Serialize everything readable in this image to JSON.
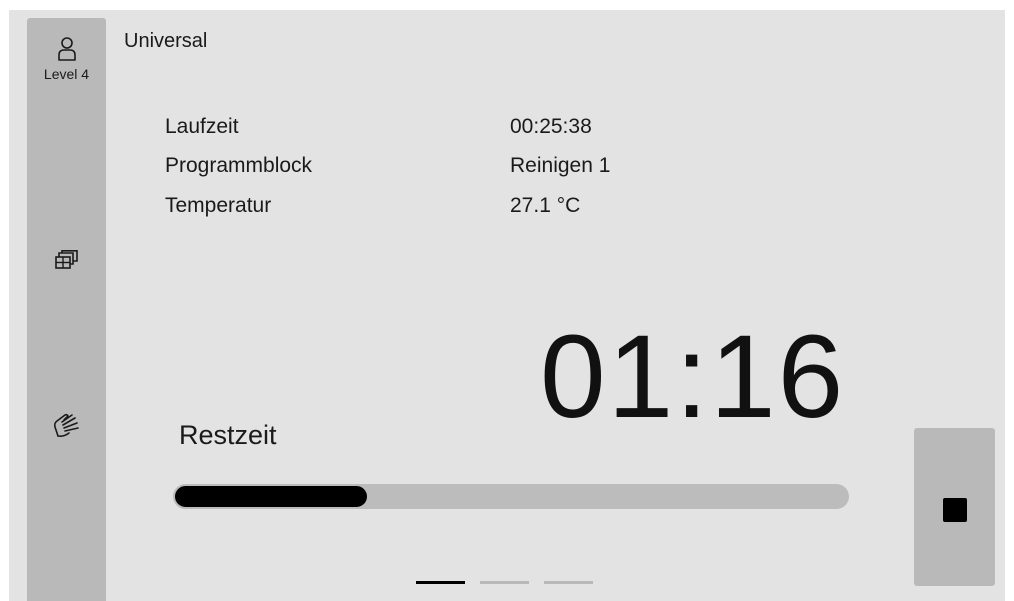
{
  "user": {
    "level_label": "Level 4",
    "icon": "user-icon"
  },
  "sidebar": {
    "items": [
      {
        "name": "user-level",
        "icon": "user-icon"
      },
      {
        "name": "load-carriers",
        "icon": "baskets-icon"
      },
      {
        "name": "hygiene",
        "icon": "hand-icon"
      }
    ]
  },
  "program": {
    "name": "Universal"
  },
  "info": {
    "runtime_label": "Laufzeit",
    "runtime_value": "00:25:38",
    "block_label": "Programmblock",
    "block_value": "Reinigen 1",
    "temperature_label": "Temperatur",
    "temperature_value": "27.1 °C"
  },
  "remaining": {
    "time": "01:16",
    "label": "Restzeit",
    "progress_percent": 29
  },
  "stop_button": {
    "icon": "stop-icon"
  },
  "pagination": {
    "count": 3,
    "active_index": 0
  },
  "colors": {
    "background": "#e3e3e3",
    "sidebar": "#b9b9b9",
    "progress_track": "#bcbcbc",
    "progress_fill": "#000000",
    "text": "#1a1a1a"
  }
}
